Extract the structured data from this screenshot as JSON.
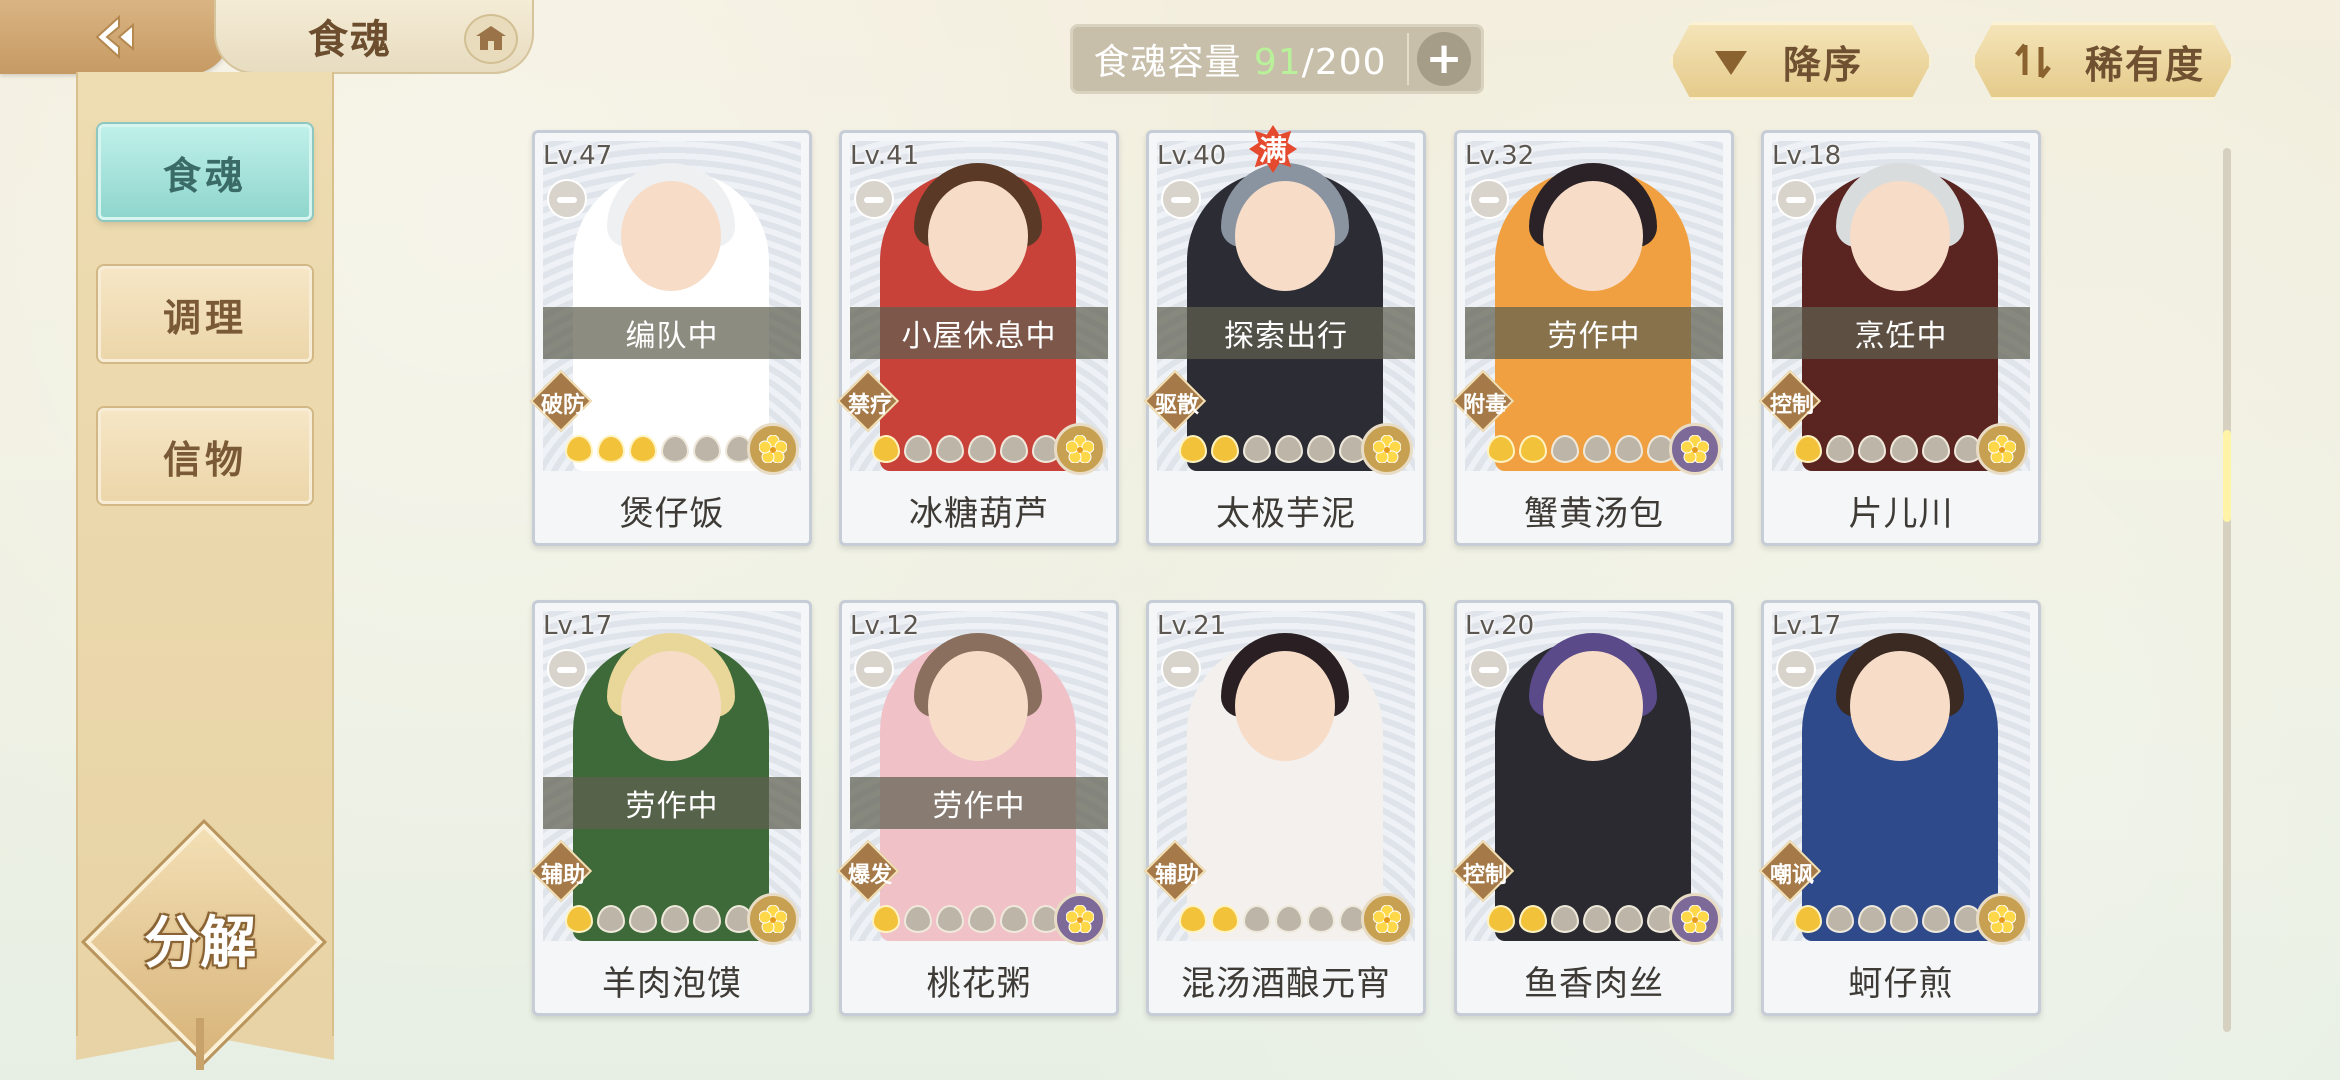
{
  "header": {
    "title": "食魂"
  },
  "sidebar": {
    "tabs": [
      {
        "label": "食魂"
      },
      {
        "label": "调理"
      },
      {
        "label": "信物"
      }
    ],
    "decompose_label": "分解"
  },
  "capacity": {
    "label": "食魂容量",
    "current": "91",
    "max": "/200",
    "plus": "+"
  },
  "sort": {
    "order_label": "降序",
    "rarity_label": "稀有度"
  },
  "colors": {
    "accent_teal": "#8fd6cd",
    "capacity_green": "#b9f09a",
    "full_badge": "#e54a2e"
  },
  "cards": [
    {
      "level": "Lv.47",
      "status": "编队中",
      "role": "破防",
      "name": "煲仔饭",
      "flames_on": 3,
      "full": "",
      "star": "gold",
      "hair": "#eef0f2",
      "outfit": "#ffffff"
    },
    {
      "level": "Lv.41",
      "status": "小屋休息中",
      "role": "禁疗",
      "name": "冰糖葫芦",
      "flames_on": 1,
      "full": "",
      "star": "gold",
      "hair": "#5a3a26",
      "outfit": "#c8423a"
    },
    {
      "level": "Lv.40",
      "status": "探索出行",
      "role": "驱散",
      "name": "太极芋泥",
      "flames_on": 2,
      "full": "满",
      "star": "gold",
      "hair": "#8a94a0",
      "outfit": "#2c2c34"
    },
    {
      "level": "Lv.32",
      "status": "劳作中",
      "role": "附毒",
      "name": "蟹黄汤包",
      "flames_on": 2,
      "full": "",
      "star": "purple",
      "hair": "#2a2226",
      "outfit": "#f0a040"
    },
    {
      "level": "Lv.18",
      "status": "烹饪中",
      "role": "控制",
      "name": "片儿川",
      "flames_on": 1,
      "full": "",
      "star": "gold",
      "hair": "#d8dcdc",
      "outfit": "#5a2420"
    },
    {
      "level": "Lv.17",
      "status": "劳作中",
      "role": "辅助",
      "name": "羊肉泡馍",
      "flames_on": 1,
      "full": "",
      "star": "gold",
      "hair": "#e9d79a",
      "outfit": "#3e6a3a"
    },
    {
      "level": "Lv.12",
      "status": "劳作中",
      "role": "爆发",
      "name": "桃花粥",
      "flames_on": 1,
      "full": "",
      "star": "purple",
      "hair": "#8a6e5e",
      "outfit": "#f0c2c8"
    },
    {
      "level": "Lv.21",
      "status": "",
      "role": "辅助",
      "name": "混汤酒酿元宵",
      "flames_on": 2,
      "full": "",
      "star": "gold",
      "hair": "#2a2024",
      "outfit": "#f3f0ee"
    },
    {
      "level": "Lv.20",
      "status": "",
      "role": "控制",
      "name": "鱼香肉丝",
      "flames_on": 2,
      "full": "",
      "star": "purple",
      "hair": "#5a4a8a",
      "outfit": "#2a2a30"
    },
    {
      "level": "Lv.17",
      "status": "",
      "role": "嘲讽",
      "name": "蚵仔煎",
      "flames_on": 1,
      "full": "",
      "star": "gold",
      "hair": "#3a2a22",
      "outfit": "#2e4a8a"
    }
  ]
}
